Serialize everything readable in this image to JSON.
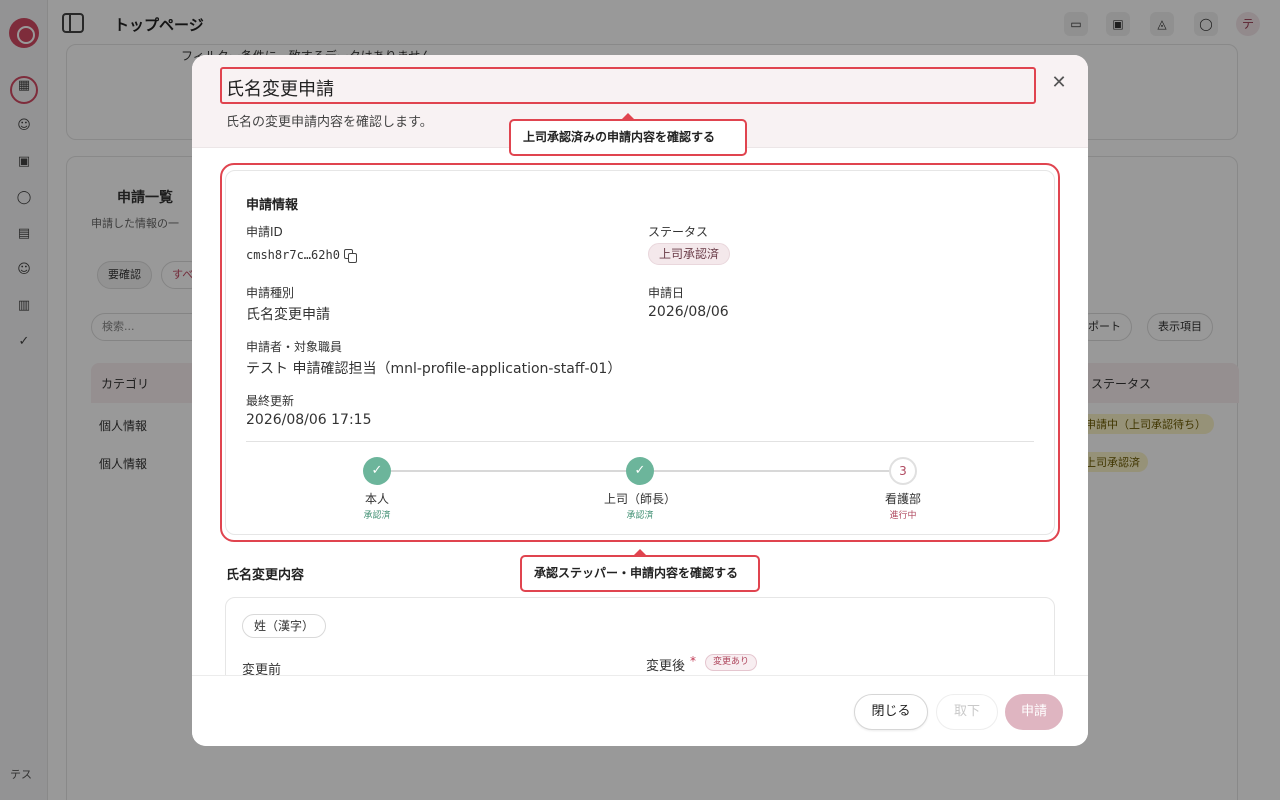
{
  "app": {
    "page_title": "トップページ",
    "user_initials": "テス",
    "avatar_initial": "テ"
  },
  "background": {
    "notice_text": "フィルター条件に一致するデータはありません",
    "list_title": "申請一覧",
    "list_desc": "申請した情報の一",
    "tab_unconfirmed": "要確認",
    "tab_all": "すべ",
    "search_placeholder": "検索...",
    "export_label": "ポート",
    "display_items_label": "表示項目",
    "col_category": "カテゴリ",
    "col_status": "ステータス",
    "rows": [
      {
        "category": "個人情報",
        "status": "申請中（上司承認待ち）"
      },
      {
        "category": "個人情報",
        "status": "上司承認済"
      }
    ]
  },
  "modal": {
    "title": "氏名変更申請",
    "description": "氏名の変更申請内容を確認します。",
    "info": {
      "section_title": "申請情報",
      "id_label": "申請ID",
      "id_value": "cmsh8r7c…62h0",
      "status_label": "ステータス",
      "status_value": "上司承認済",
      "type_label": "申請種別",
      "type_value": "氏名変更申請",
      "date_label": "申請日",
      "date_value": "2026/08/06",
      "applicant_label": "申請者・対象職員",
      "applicant_value": "テスト 申請確認担当（mnl-profile-application-staff-01）",
      "updated_label": "最終更新",
      "updated_value": "2026/08/06 17:15"
    },
    "stepper": [
      {
        "name": "本人",
        "state": "承認済",
        "status": "done",
        "number": ""
      },
      {
        "name": "上司（師長）",
        "state": "承認済",
        "status": "done",
        "number": ""
      },
      {
        "name": "看護部",
        "state": "進行中",
        "status": "current",
        "number": "3"
      }
    ],
    "change": {
      "section_title": "氏名変更内容",
      "field_chip": "姓（漢字）",
      "before_label": "変更前",
      "after_label": "変更後",
      "required_mark": "*",
      "changed_badge": "変更あり"
    },
    "footer": {
      "close_label": "閉じる",
      "withdraw_label": "取下",
      "apply_label": "申請"
    }
  },
  "annotations": {
    "callout_1": "上司承認済みの申請内容を確認する",
    "callout_2": "承認ステッパー・申請内容を確認する"
  },
  "colors": {
    "accent": "#d24a63",
    "annotation_red": "#e0444f",
    "step_done": "#6cb59b",
    "overlay": "rgba(0,0,0,0.40)"
  }
}
